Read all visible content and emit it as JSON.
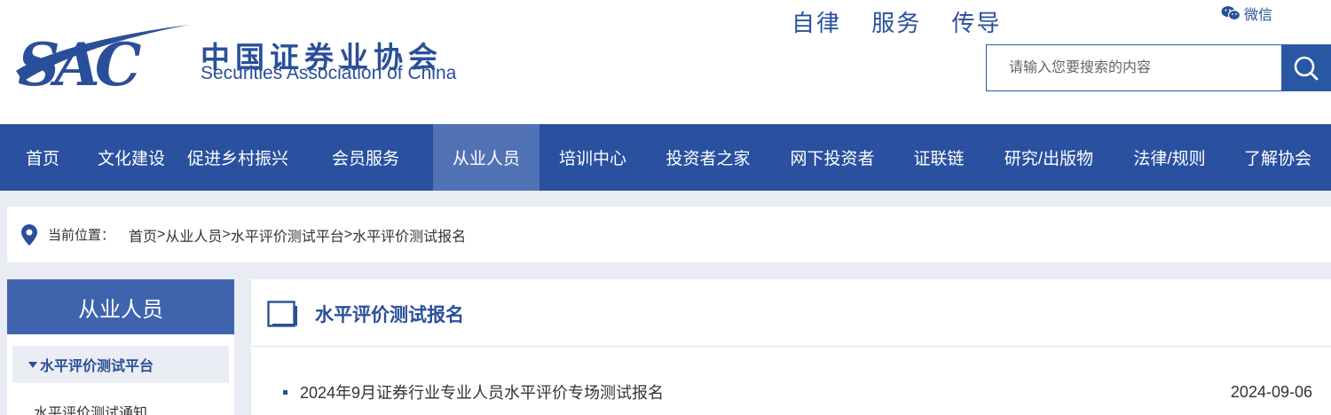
{
  "header": {
    "logo_cn": "中国证券业协会",
    "logo_en": "Securities Association of China",
    "logo_mark": "SAC",
    "slogan": "自律 服务 传导",
    "wechat_label": "微信",
    "wechat_icon": "wechat-icon"
  },
  "search": {
    "placeholder": "请输入您要搜索的内容",
    "button_icon": "search-icon"
  },
  "nav": {
    "items": [
      {
        "label": "首页"
      },
      {
        "label": "文化建设"
      },
      {
        "label": "促进乡村振兴"
      },
      {
        "label": "会员服务"
      },
      {
        "label": "从业人员"
      },
      {
        "label": "培训中心"
      },
      {
        "label": "投资者之家"
      },
      {
        "label": "网下投资者"
      },
      {
        "label": "证联链"
      },
      {
        "label": "研究/出版物"
      },
      {
        "label": "法律/规则"
      },
      {
        "label": "了解协会"
      }
    ],
    "active_label": "从业人员"
  },
  "breadcrumb": {
    "label": "当前位置：",
    "items": [
      "首页",
      "从业人员",
      "水平评价测试平台",
      "水平评价测试报名"
    ],
    "separator": ">"
  },
  "sidebar": {
    "title": "从业人员",
    "group_label": "水平评价测试平台",
    "sub_item": "水平评价测试通知"
  },
  "main": {
    "title": "水平评价测试报名",
    "items": [
      {
        "title": "2024年9月证券行业专业人员水平评价专场测试报名",
        "date": "2024-09-06"
      }
    ]
  },
  "colors": {
    "brand": "#2a50a0",
    "nav_active": "#5272b6",
    "sidebar_title": "#3f64ad",
    "page_bg": "#e9ecf3"
  }
}
